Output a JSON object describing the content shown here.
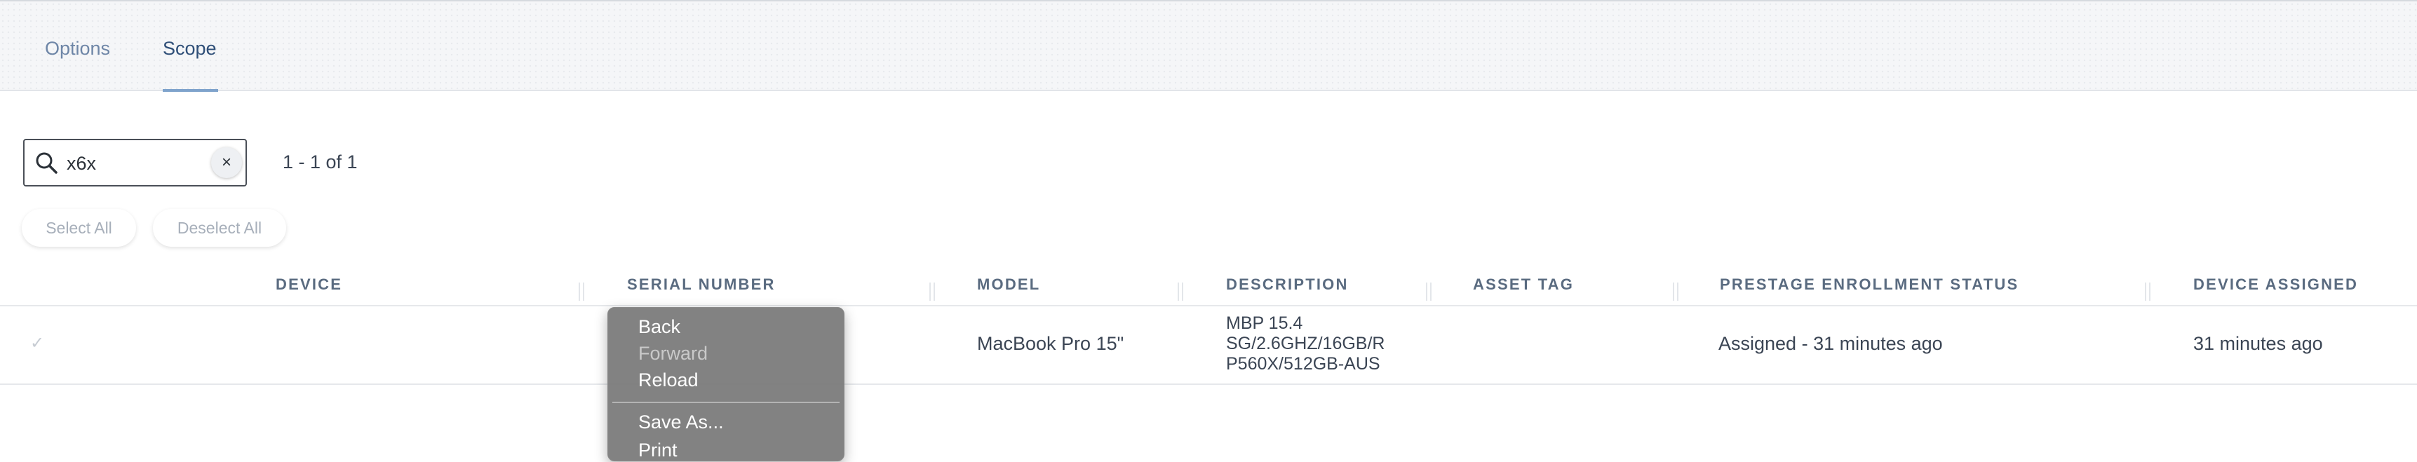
{
  "tabs": [
    {
      "label": "Options"
    },
    {
      "label": "Scope"
    }
  ],
  "search": {
    "value": "x6x",
    "clear_label": "×",
    "result_count": "1 - 1 of 1"
  },
  "actions": {
    "select_all": "Select All",
    "deselect_all": "Deselect All"
  },
  "table": {
    "columns": [
      "DEVICE",
      "SERIAL NUMBER",
      "MODEL",
      "DESCRIPTION",
      "ASSET TAG",
      "PRESTAGE ENROLLMENT STATUS",
      "DEVICE ASSIGNED"
    ],
    "rows": [
      {
        "checked": "✓",
        "model": "MacBook Pro 15\"",
        "description": [
          "MBP 15.4",
          "SG/2.6GHZ/16GB/R",
          "P560X/512GB-AUS"
        ],
        "status": "Assigned - 31 minutes ago",
        "assigned": "31 minutes ago"
      }
    ]
  },
  "context_menu": {
    "items": [
      "Back",
      "Forward",
      "Reload",
      "Save As...",
      "Print"
    ],
    "disabled": [
      "Forward"
    ]
  },
  "colors": {
    "active_tab": "#2f4f78",
    "inactive_tab": "#6e86a7",
    "tab_underline": "#7fa3cc",
    "menu_background": "#787878"
  }
}
